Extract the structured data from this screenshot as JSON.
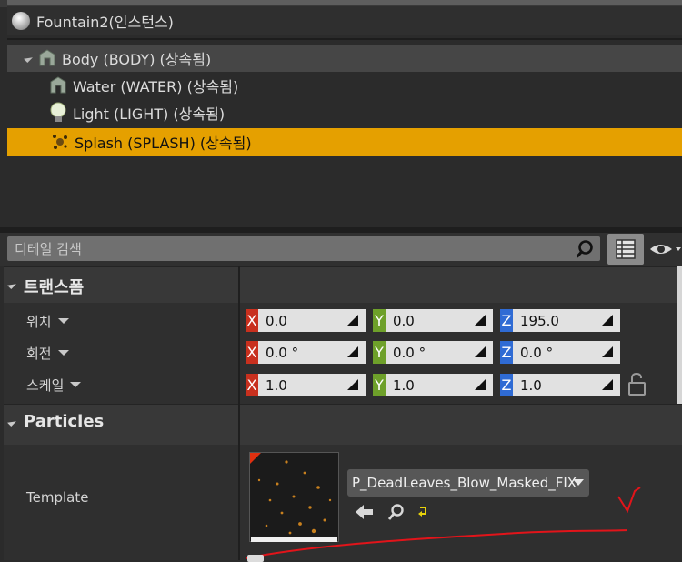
{
  "outliner": {
    "actor_label": "Fountain2(인스턴스)",
    "components": [
      {
        "label": "Body (BODY) (상속됨)"
      },
      {
        "label": "Water (WATER) (상속됨)"
      },
      {
        "label": "Light (LIGHT) (상속됨)"
      },
      {
        "label": "Splash (SPLASH) (상속됨)"
      }
    ],
    "selected_index": 3,
    "selection_color": "#e5a000"
  },
  "details": {
    "search_placeholder": "디테일 검색",
    "transform": {
      "title": "트랜스폼",
      "location": {
        "label": "위치",
        "x": "0.0",
        "y": "0.0",
        "z": "195.0"
      },
      "rotation": {
        "label": "회전",
        "x": "0.0 °",
        "y": "0.0 °",
        "z": "0.0 °"
      },
      "scale": {
        "label": "스케일",
        "x": "1.0",
        "y": "1.0",
        "z": "1.0"
      }
    },
    "axis_tags": {
      "x": "X",
      "y": "Y",
      "z": "Z"
    },
    "axis_colors": {
      "x": "#c8301e",
      "y": "#6ea02a",
      "z": "#2f6bd4"
    },
    "particles": {
      "title": "Particles",
      "template_label": "Template",
      "template_value": "P_DeadLeaves_Blow_Masked_FIX"
    }
  }
}
